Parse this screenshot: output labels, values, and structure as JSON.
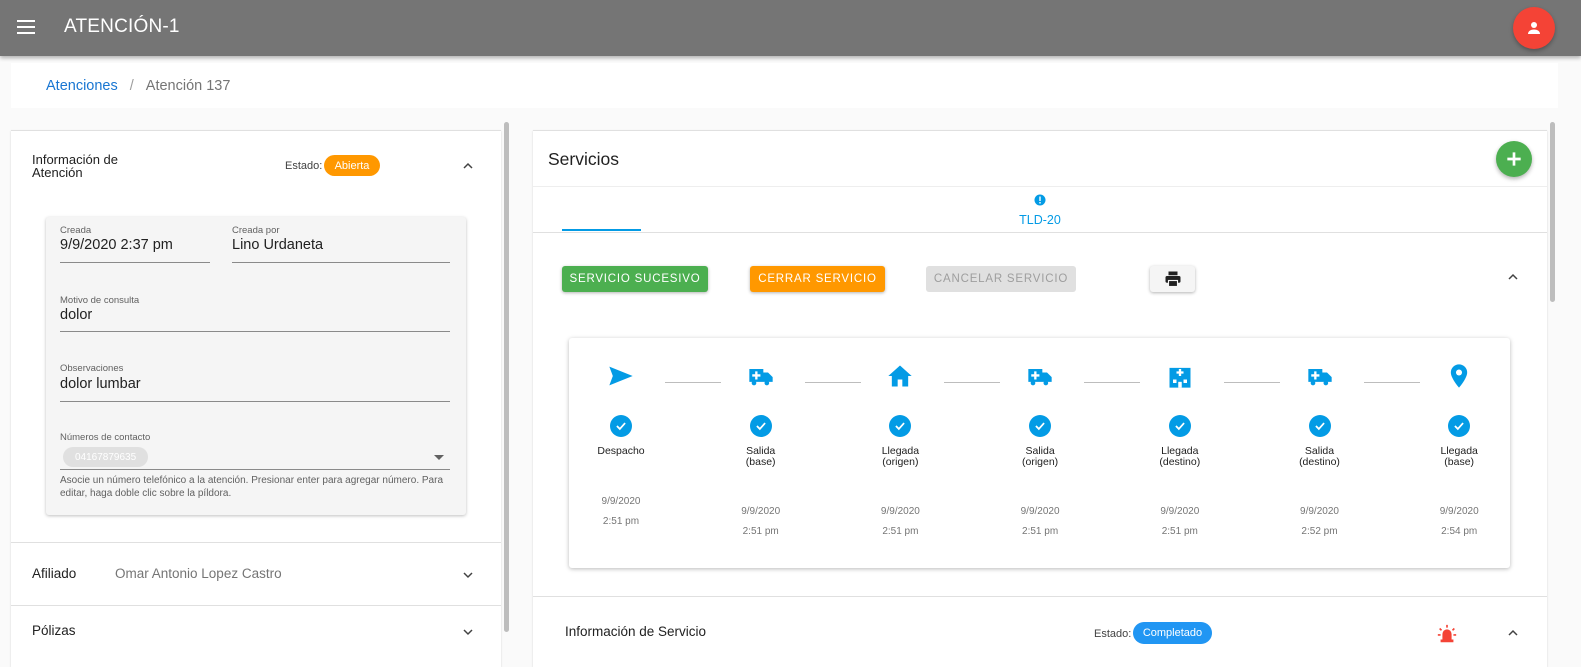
{
  "app": {
    "title": "ATENCIÓN-1"
  },
  "icons": {
    "menu": "menu-icon",
    "user": "person-icon",
    "add": "plus-icon",
    "print": "printer-icon",
    "alarm": "siren-icon"
  },
  "colors": {
    "appbar": "#757575",
    "accent": "#039be5",
    "green": "#4caf50",
    "orange": "#ff9800",
    "red": "#f44336"
  },
  "breadcrumb": {
    "parent": "Atenciones",
    "separator": "/",
    "current": "Atención 137"
  },
  "atencion": {
    "title": "Información de Atención",
    "estado_label": "Estado:",
    "estado": "Abierta",
    "fields": {
      "creada_label": "Creada",
      "creada_value": "9/9/2020 2:37 pm",
      "creada_por_label": "Creada por",
      "creada_por_value": "Lino Urdaneta",
      "motivo_label": "Motivo de consulta",
      "motivo_value": "dolor",
      "observaciones_label": "Observaciones",
      "observaciones_value": "dolor lumbar",
      "contactos_label": "Números de contacto",
      "contactos_chip": "04167879635",
      "contactos_helper": "Asocie un número telefónico a la atención. Presionar enter para agregar número. Para editar, haga doble clic sobre la píldora."
    }
  },
  "afiliado": {
    "label": "Afiliado",
    "value": "Omar Antonio Lopez Castro"
  },
  "polizas": {
    "label": "Pólizas"
  },
  "servicios": {
    "title": "Servicios",
    "tab_label": "TLD-20",
    "buttons": {
      "sucesivo": "SERVICIO SUCESIVO",
      "cerrar": "CERRAR SERVICIO",
      "cancelar": "CANCELAR SERVICIO"
    },
    "steps": [
      {
        "icon": "send-icon",
        "label": "Despacho",
        "date": "9/9/2020",
        "time": "2:51 pm"
      },
      {
        "icon": "ambulance-icon",
        "label": "Salida (base)",
        "date": "9/9/2020",
        "time": "2:51 pm"
      },
      {
        "icon": "home-icon",
        "label": "Llegada (origen)",
        "date": "9/9/2020",
        "time": "2:51 pm"
      },
      {
        "icon": "ambulance-icon",
        "label": "Salida (origen)",
        "date": "9/9/2020",
        "time": "2:51 pm"
      },
      {
        "icon": "hospital-icon",
        "label": "Llegada (destino)",
        "date": "9/9/2020",
        "time": "2:51 pm"
      },
      {
        "icon": "ambulance-icon",
        "label": "Salida (destino)",
        "date": "9/9/2020",
        "time": "2:52 pm"
      },
      {
        "icon": "location-pin-icon",
        "label": "Llegada (base)",
        "date": "9/9/2020",
        "time": "2:54 pm"
      }
    ],
    "info": {
      "title": "Información de Servicio",
      "estado_label": "Estado:",
      "estado": "Completado"
    }
  }
}
